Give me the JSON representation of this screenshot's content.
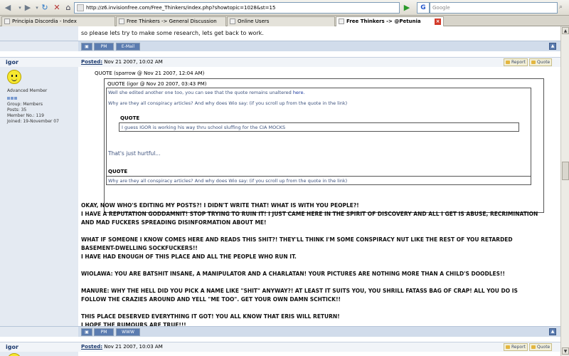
{
  "browser": {
    "url": "http://z6.invisionfree.com/Free_Thinkers/index.php?showtopic=1028&st=15",
    "search_placeholder": "Google",
    "search_engine_letter": "G"
  },
  "tabs": [
    {
      "label": "Principia Discordia - Index"
    },
    {
      "label": "Free Thinkers -> General Discussion"
    },
    {
      "label": "Online Users"
    },
    {
      "label": "Free Thinkers -> @Petunia",
      "active": true
    }
  ],
  "prev_post": {
    "text": "so please lets try to make some research, lets get back to work.",
    "buttons": {
      "pm": "PM",
      "email": "E-Mail"
    }
  },
  "post": {
    "username": "igor",
    "posted_label": "Posted:",
    "posted_date": "Nov 21 2007, 10:02 AM",
    "report": "Report",
    "quote_btn": "Quote",
    "member_title": "Advanced Member",
    "group": "Group: Members",
    "posts": "Posts: 35",
    "member_no": "Member No.: 119",
    "joined": "Joined: 19-November 07",
    "quote1_header": "QUOTE (sparrow @ Nov 21 2007, 12:04 AM)",
    "quote2_header": "QUOTE (igor @ Nov 20 2007, 03:43 PM)",
    "q2_line1_pre": "Well she edited another one too, you can see that the quote remains unaltered ",
    "q2_line1_link": "here.",
    "q2_line2": "Why are they all conspiracy articles? And why does Wio say: (if you scroll up from the quote in the link)",
    "quote3_header": "QUOTE",
    "q3_text": "I guess IGOR is working his way thru school sluffing for the CIA MOCKS",
    "q1_tail": "That's just hurtful...",
    "quote4_header": "QUOTE",
    "q4_text": "Why are they all conspiracy articles? And why does Wio say: (if you scroll up from the quote in the link)",
    "body": [
      "OKAY, NOW WHO'S EDITING MY POSTS?! I DIDN'T WRITE THAT! WHAT IS WITH YOU PEOPLE?!",
      "I HAVE A REPUTATION GODDAMNIT! STOP TRYING TO RUIN IT! I JUST CAME HERE IN THE SPIRIT OF DISCOVERY AND ALL I GET IS ABUSE, RECRIMINATION",
      "AND MAD FUCKERS SPREADING DISINFORMATION ABOUT ME!",
      "",
      "WHAT IF SOMEONE I KNOW COMES HERE AND READS THIS SHIT?! THEY'LL THINK I'M SOME CONSPIRACY NUT LIKE THE REST OF YOU RETARDED",
      "BASEMENT-DWELLING SOCKFUCKERS!!",
      "I HAVE HAD ENOUGH OF THIS PLACE AND ALL THE PEOPLE WHO RUN IT.",
      "",
      "WIOLAWA: YOU ARE BATSHIT INSANE, A MANIPULATOR AND A CHARLATAN! YOUR PICTURES ARE NOTHING MORE THAN A CHILD'S DOODLES!!",
      "",
      "MANURE: WHY THE HELL DID YOU PICK A NAME LIKE \"SHIT\" ANYWAY?! AT LEAST IT SUITS YOU, YOU SHRILL FATASS BAG OF CRAP! ALL YOU DO IS",
      "FOLLOW THE CRAZIES AROUND AND YELL \"ME TOO\". GET YOUR OWN DAMN SCHTICK!!",
      "",
      "THIS PLACE DESERVED EVERYTHING IT GOT! YOU ALL KNOW THAT ERIS WILL RETURN!",
      "I HOPE THE RUMOURS ARE TRUE!!!"
    ],
    "buttons": {
      "pm": "PM",
      "www": "WWW"
    }
  },
  "next_post": {
    "username": "igor",
    "posted_label": "Posted:",
    "posted_date": "Nov 21 2007, 10:03 AM",
    "report": "Report",
    "quote_btn": "Quote"
  }
}
